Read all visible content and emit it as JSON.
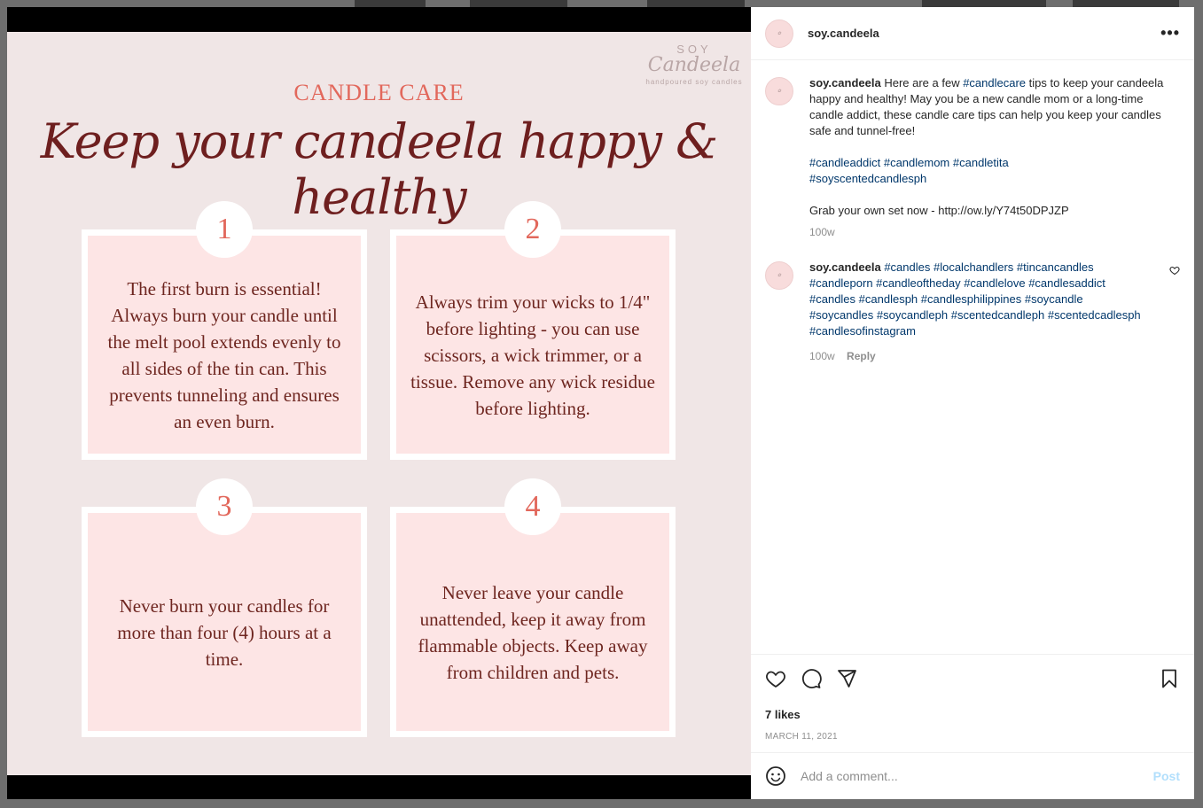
{
  "post": {
    "brand": {
      "small": "SOY",
      "name": "Candeela",
      "tagline": "handpoured soy candles"
    },
    "heading": "CANDLE CARE",
    "script_title": "Keep your candeela happy & healthy",
    "cards": [
      {
        "number": "1",
        "text": "The first burn is essential! Always burn your candle until the melt pool extends evenly to all sides of the tin can. This prevents tunneling and ensures an even burn."
      },
      {
        "number": "2",
        "text": "Always trim your wicks to 1/4\" before lighting - you can use scissors, a wick trimmer, or a tissue. Remove any wick residue before lighting."
      },
      {
        "number": "3",
        "text": "Never burn your candles for more than four (4) hours at a time."
      },
      {
        "number": "4",
        "text": "Never leave your candle unattended, keep it away from flammable objects. Keep away from children and pets."
      }
    ]
  },
  "header": {
    "username": "soy.candeela",
    "more_label": "•••"
  },
  "caption": {
    "username": "soy.candeela",
    "text_before": "Here are a few ",
    "tag1": "#candlecare",
    "text_after": " tips to keep your candeela happy and healthy! May you be a new candle mom or a long-time candle addict, these candle care tips can help you keep your candles safe and tunnel-free!",
    "tags_line1": "#candleaddict #candlemom #candletita",
    "tags_line2": "#soyscentedcandlesph",
    "grab_text": "Grab your own set now - http://ow.ly/Y74t50DPJZP",
    "time": "100w"
  },
  "comment": {
    "username": "soy.candeela",
    "tags": "#candles #localchandlers #tincancandles #candleporn #candleoftheday #candlelove #candlesaddict #candles #candlesph #candlesphilippines #soycandle #soycandles #soycandleph #scentedcandleph #scentedcadlesph #candlesofinstagram",
    "time": "100w",
    "reply_label": "Reply"
  },
  "actions": {
    "likes": "7 likes",
    "date": "MARCH 11, 2021"
  },
  "add_comment": {
    "placeholder": "Add a comment...",
    "post_label": "Post"
  }
}
